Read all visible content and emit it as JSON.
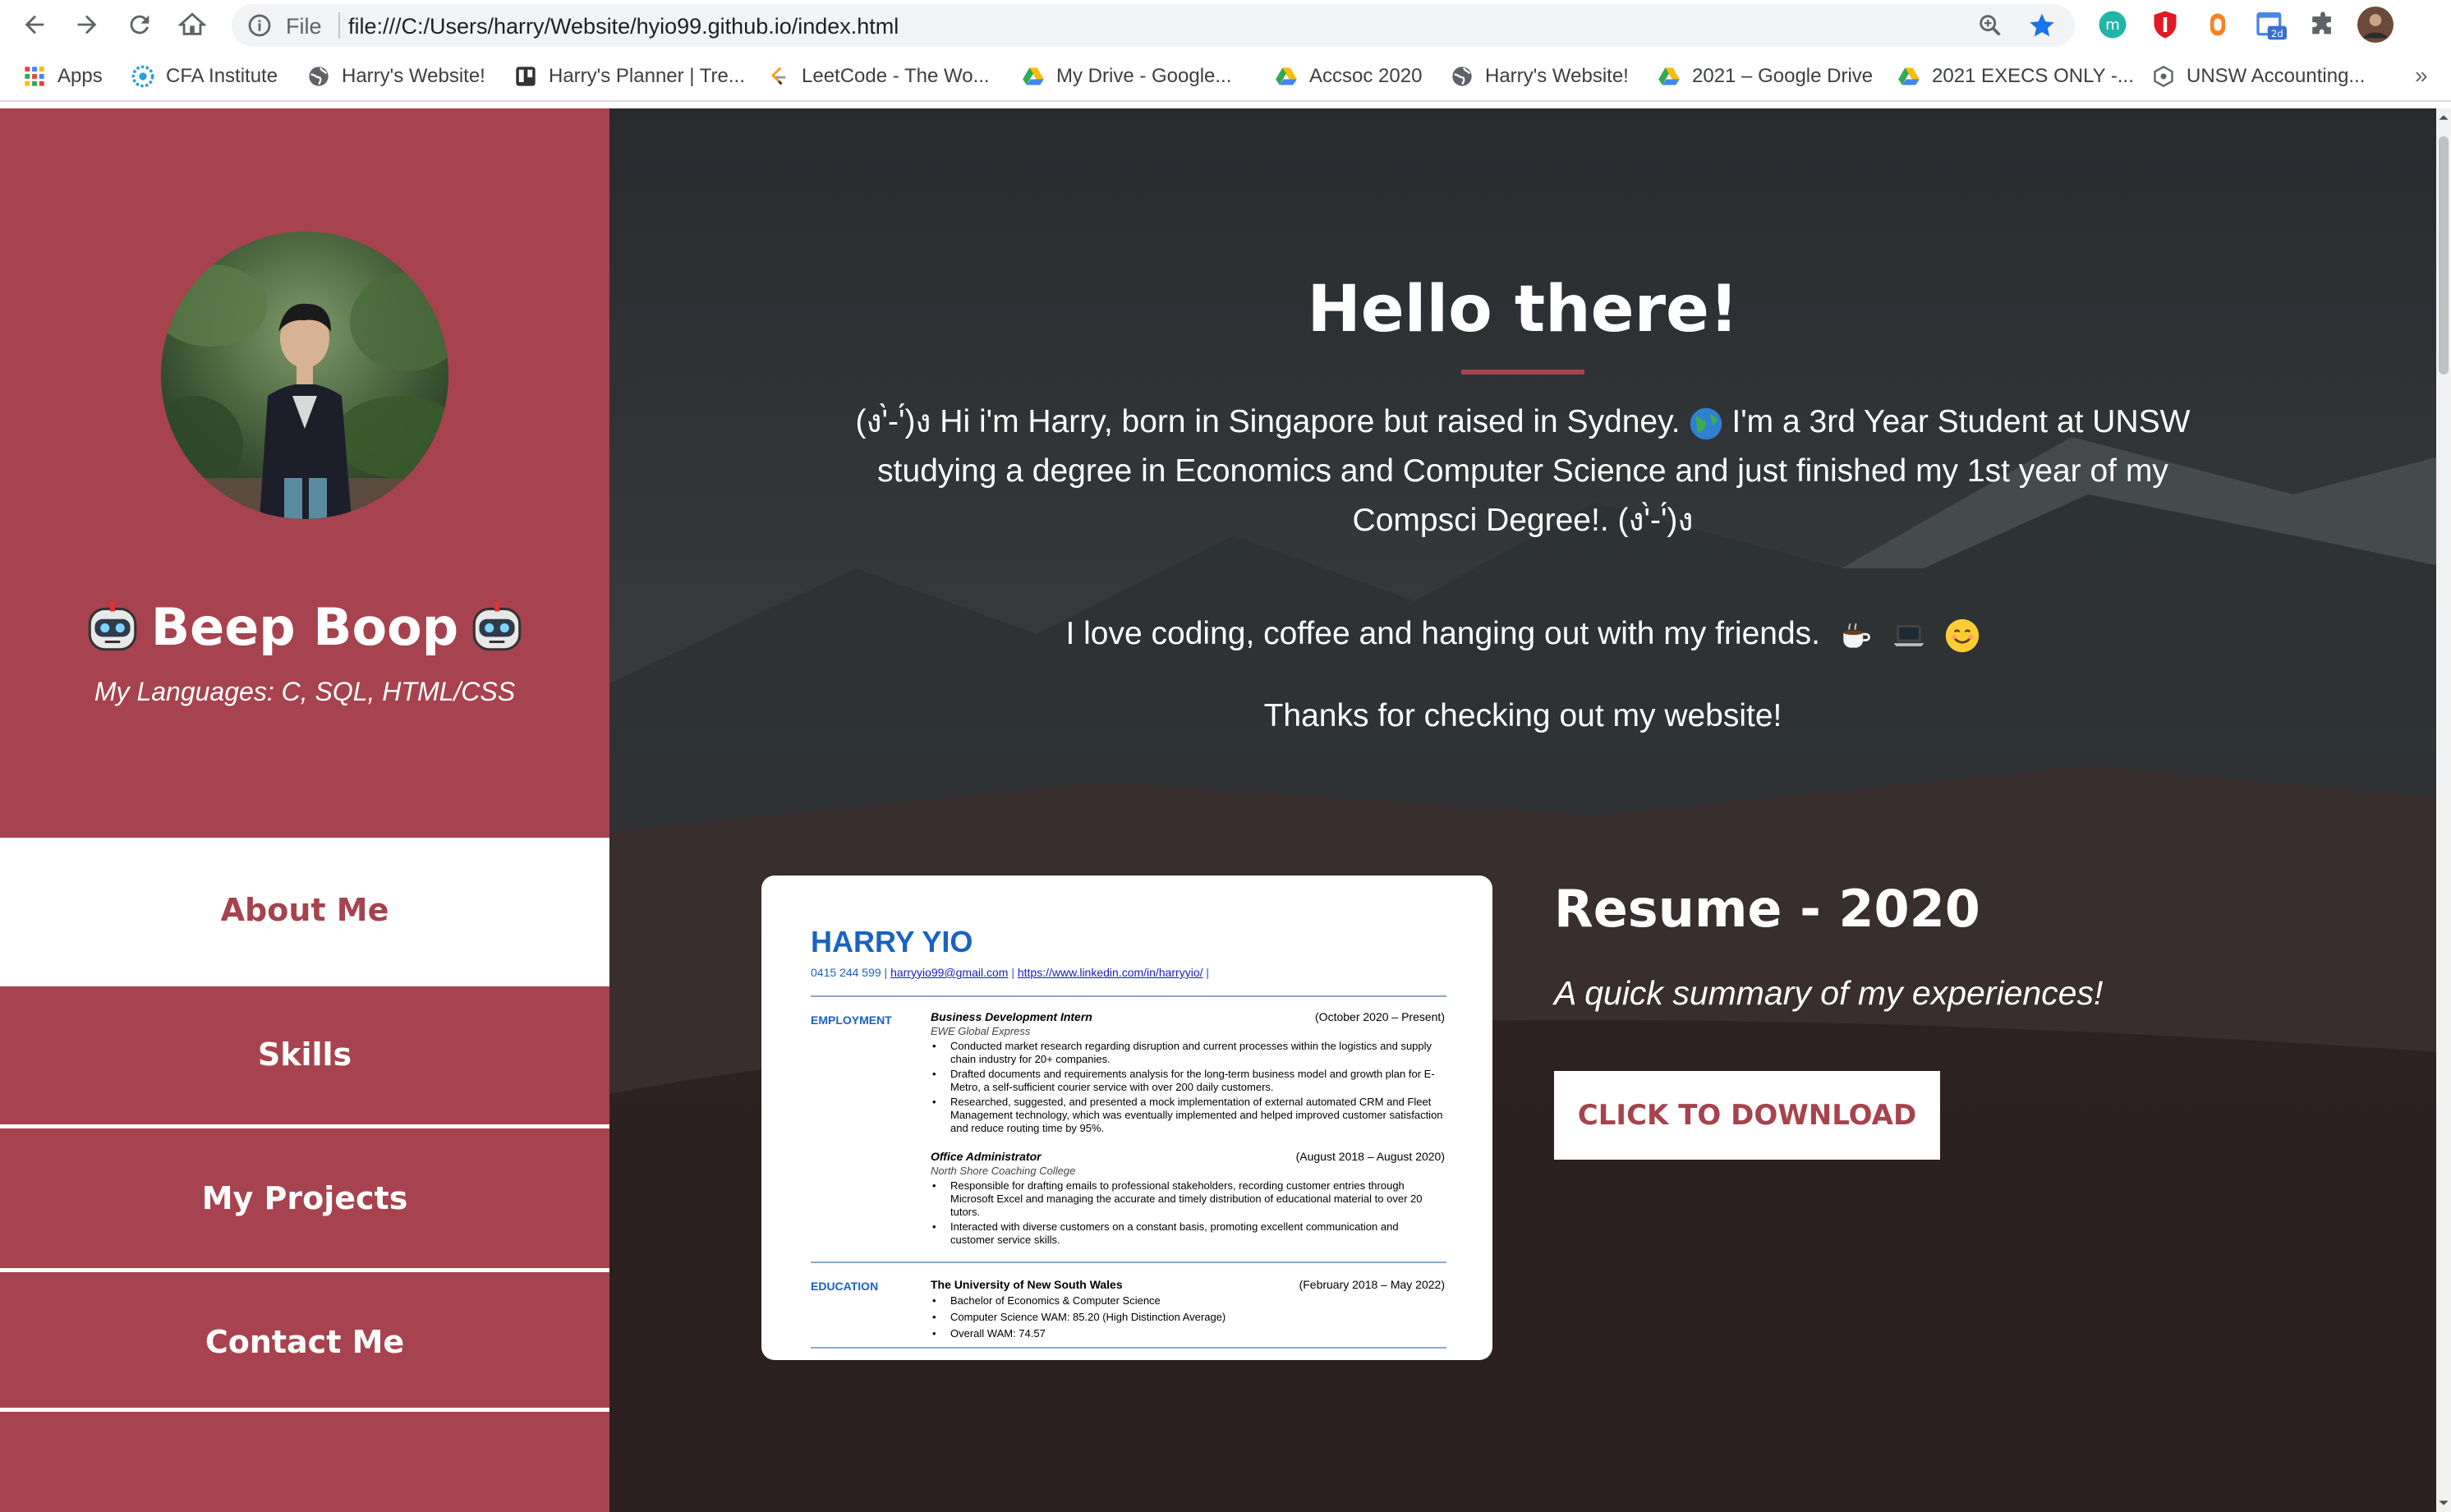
{
  "browser": {
    "url_scheme_label": "File",
    "url": "file:///C:/Users/harry/Website/hyio99.github.io/index.html",
    "nav_icons": [
      "back-arrow-icon",
      "forward-arrow-icon",
      "reload-icon",
      "home-icon"
    ],
    "extensions": [
      "m-extension-icon",
      "shield-extension-icon",
      "orange-extension-icon",
      "calendar-extension-icon",
      "puzzle-extensions-icon",
      "profile-avatar-icon"
    ],
    "calendar_badge": "2d"
  },
  "bookmarks": [
    {
      "label": "Apps",
      "icon": "apps-grid-icon"
    },
    {
      "label": "CFA Institute",
      "icon": "cfa-icon"
    },
    {
      "label": "Harry's Website!",
      "icon": "globe-icon"
    },
    {
      "label": "Harry's Planner | Tre...",
      "icon": "trello-icon"
    },
    {
      "label": "LeetCode - The Wo...",
      "icon": "leetcode-icon"
    },
    {
      "label": "My Drive - Google...",
      "icon": "google-drive-icon"
    },
    {
      "label": "Accsoc 2020",
      "icon": "google-drive-icon"
    },
    {
      "label": "Harry's Website!",
      "icon": "globe-icon"
    },
    {
      "label": "2021 – Google Drive",
      "icon": "google-drive-icon"
    },
    {
      "label": "2021 EXECS ONLY -...",
      "icon": "google-drive-icon"
    },
    {
      "label": "UNSW Accounting...",
      "icon": "unsw-icon"
    }
  ],
  "bookmarks_more": "»",
  "sidebar": {
    "title": "Beep Boop",
    "subtitle": "My Languages: C, SQL, HTML/CSS",
    "nav": [
      {
        "label": "About Me",
        "active": true
      },
      {
        "label": "Skills",
        "active": false
      },
      {
        "label": "My Projects",
        "active": false
      },
      {
        "label": "Contact Me",
        "active": false
      }
    ]
  },
  "main": {
    "heading": "Hello there!",
    "intro_part1": "(ง'̀-'́)ง Hi i'm Harry, born in Singapore but raised in Sydney.",
    "intro_part2": " I'm a 3rd Year Student at UNSW studying a degree in Economics and Computer Science and just finished my 1st year of my Compsci Degree!. (ง'̀-'́)ง",
    "love_text": "I love coding, coffee and hanging out with my friends.",
    "thanks_text": "Thanks for checking out my website!",
    "resume_title": "Resume - 2020",
    "resume_subtitle": "A quick summary of my experiences!",
    "download_label": "CLICK TO DOWNLOAD"
  },
  "resume_preview": {
    "name": "HARRY YIO",
    "phone": "0415 244 599 |",
    "email": "harryyio99@gmail.com",
    "linkedin": "https://www.linkedin.com/in/harryyio/",
    "employment_label": "EMPLOYMENT",
    "job1_title": "Business Development Intern",
    "job1_dates": "(October 2020 – Present)",
    "job1_org": "EWE Global Express",
    "job1_b1": "Conducted market research regarding disruption and current processes within the logistics and supply chain industry for 20+ companies.",
    "job1_b2": "Drafted documents and requirements analysis for the long-term business model and growth plan for E-Metro, a self-sufficient courier service with over 200 daily customers.",
    "job1_b3": "Researched, suggested, and presented a mock implementation of external automated CRM and Fleet Management technology, which was eventually implemented and helped improved customer satisfaction and reduce routing time by 95%.",
    "job2_title": "Office Administrator",
    "job2_dates": "(August 2018 – August 2020)",
    "job2_org": "North Shore Coaching College",
    "job2_b1": "Responsible for drafting emails to professional stakeholders, recording customer entries through Microsoft Excel and managing the accurate and timely distribution of educational material to over 20 tutors.",
    "job2_b2": "Interacted with diverse customers on a constant basis, promoting excellent communication and customer service skills.",
    "education_label": "EDUCATION",
    "edu_title": "The University of New South Wales",
    "edu_dates": "(February 2018 – May 2022)",
    "edu_b1": "Bachelor of Economics & Computer Science",
    "edu_b2": "Computer Science WAM: 85.20 (High Distinction Average)",
    "edu_b3": "Overall WAM: 74.57"
  },
  "colors": {
    "accent": "#a6434f",
    "main_bg": "#2c2d2f",
    "resume_blue": "#1a62c2"
  }
}
